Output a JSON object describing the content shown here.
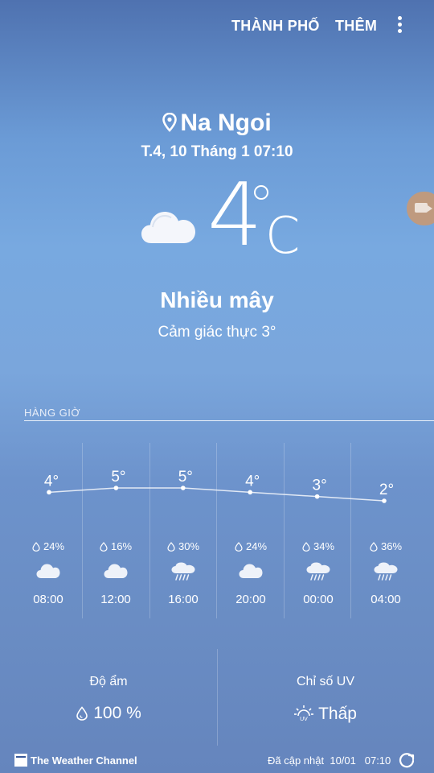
{
  "header": {
    "city_button": "THÀNH PHỐ",
    "more_button": "THÊM"
  },
  "location": {
    "name": "Na Ngoi",
    "datetime": "T.4, 10 Tháng 1 07:10"
  },
  "current": {
    "temp": "4",
    "unit": "C",
    "condition": "Nhiều mây",
    "feels_like": "Cảm giác thực 3°",
    "icon": "cloud-icon"
  },
  "hourly": {
    "label": "HÀNG GIỜ",
    "items": [
      {
        "time": "08:00",
        "temp_label": "4°",
        "temp": 4,
        "precip": "24%",
        "icon": "cloud-icon"
      },
      {
        "time": "12:00",
        "temp_label": "5°",
        "temp": 5,
        "precip": "16%",
        "icon": "cloud-icon"
      },
      {
        "time": "16:00",
        "temp_label": "5°",
        "temp": 5,
        "precip": "30%",
        "icon": "rain-cloud-icon"
      },
      {
        "time": "20:00",
        "temp_label": "4°",
        "temp": 4,
        "precip": "24%",
        "icon": "cloud-icon"
      },
      {
        "time": "00:00",
        "temp_label": "3°",
        "temp": 3,
        "precip": "34%",
        "icon": "rain-cloud-icon"
      },
      {
        "time": "04:00",
        "temp_label": "2°",
        "temp": 2,
        "precip": "36%",
        "icon": "rain-cloud-icon"
      }
    ]
  },
  "details": {
    "humidity_title": "Độ ẩm",
    "humidity_value": "100 %",
    "uv_title": "Chỉ số UV",
    "uv_value": "Thấp"
  },
  "footer": {
    "provider": "The Weather Channel",
    "updated_label": "Đã cập nhật",
    "updated_date": "10/01",
    "updated_time": "07:10"
  }
}
